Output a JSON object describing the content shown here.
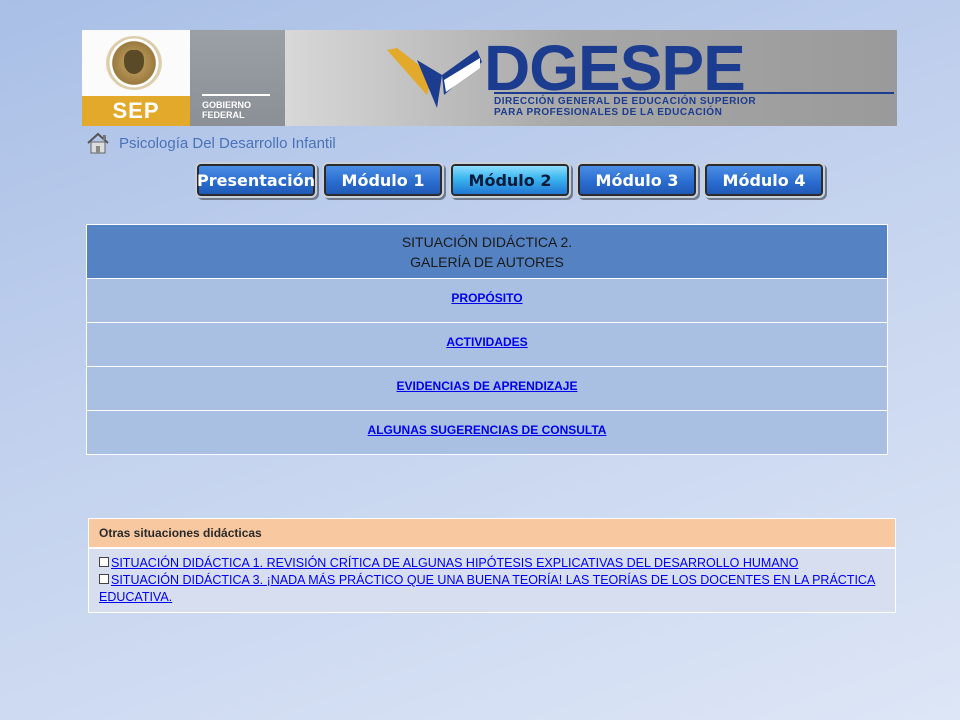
{
  "banner": {
    "sep_label": "SEP",
    "gobierno_line1": "GOBIERNO",
    "gobierno_line2": "FEDERAL",
    "dgespe_title": "DGESPE",
    "dgespe_line1": "DIRECCIÓN GENERAL DE EDUCACIÓN SUPERIOR",
    "dgespe_line2": "PARA PROFESIONALES DE LA EDUCACIÓN"
  },
  "breadcrumb": {
    "icon": "home-icon",
    "title": "Psicología Del Desarrollo Infantil"
  },
  "modules": {
    "items": [
      "Presentación",
      "Módulo 1",
      "Módulo 2",
      "Módulo 3",
      "Módulo 4"
    ],
    "active": "Módulo 2"
  },
  "main": {
    "header_line1": "SITUACIÓN DIDÁCTICA 2.",
    "header_line2": "GALERÍA DE AUTORES",
    "links": [
      "PROPÓSITO",
      "ACTIVIDADES",
      "EVIDENCIAS DE APRENDIZAJE",
      "ALGUNAS SUGERENCIAS DE CONSULTA"
    ]
  },
  "other": {
    "header": "Otras situaciones didácticas",
    "items": [
      "SITUACIÓN DIDÁCTICA 1. REVISIÓN CRÍTICA DE ALGUNAS HIPÓTESIS EXPLICATIVAS DEL DESARROLLO HUMANO",
      "SITUACIÓN DIDÁCTICA 3. ¡NADA MÁS PRÁCTICO QUE UNA BUENA TEORÍA! LAS TEORÍAS DE LOS DOCENTES EN LA PRÁCTICA EDUCATIVA."
    ]
  },
  "colors": {
    "header_blue": "#5582c2",
    "row_blue": "#a9c0e2",
    "link_blue": "#0000ee",
    "orange_header": "#f8c8a0"
  }
}
